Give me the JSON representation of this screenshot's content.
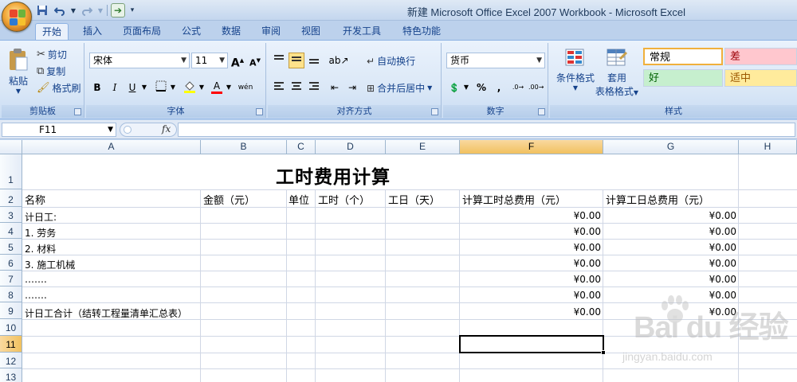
{
  "window": {
    "title": "新建 Microsoft Office Excel 2007 Workbook - Microsoft Excel"
  },
  "quick_access": {
    "save_icon": "save-icon",
    "undo_icon": "undo-icon",
    "redo_icon": "redo-icon",
    "run_icon": "arrow-right-icon"
  },
  "tabs": [
    {
      "label": "开始",
      "active": true
    },
    {
      "label": "插入"
    },
    {
      "label": "页面布局"
    },
    {
      "label": "公式"
    },
    {
      "label": "数据"
    },
    {
      "label": "审阅"
    },
    {
      "label": "视图"
    },
    {
      "label": "开发工具"
    },
    {
      "label": "特色功能"
    }
  ],
  "ribbon": {
    "clipboard": {
      "group_label": "剪贴板",
      "paste": "粘贴",
      "cut": "剪切",
      "copy": "复制",
      "format_painter": "格式刷"
    },
    "font": {
      "group_label": "字体",
      "font_name": "宋体",
      "font_size": "11",
      "grow": "A",
      "shrink": "A",
      "bold": "B",
      "italic": "I",
      "underline": "U",
      "font_color_letter": "A",
      "phonetic": "wén"
    },
    "alignment": {
      "group_label": "对齐方式",
      "wrap_text": "自动换行",
      "merge_center": "合并后居中"
    },
    "number": {
      "group_label": "数字",
      "format": "货币",
      "percent": "%",
      "comma": ","
    },
    "styles": {
      "group_label": "样式",
      "conditional_formatting": "条件格式",
      "format_as_table_1": "套用",
      "format_as_table_2": "表格格式",
      "normal": "常规",
      "bad": "差",
      "good": "好",
      "neutral": "适中",
      "colors": {
        "bad_bg": "#ffc7ce",
        "bad_fg": "#9c0006",
        "good_bg": "#c6efce",
        "good_fg": "#006100",
        "neutral_bg": "#ffeb9c",
        "neutral_fg": "#9c5700"
      }
    }
  },
  "formula_bar": {
    "name_box": "F11",
    "fx": "fx",
    "content": ""
  },
  "sheet": {
    "columns": [
      "A",
      "B",
      "C",
      "D",
      "E",
      "F",
      "G",
      "H"
    ],
    "selected_column": "F",
    "rows": [
      "1",
      "2",
      "3",
      "4",
      "5",
      "6",
      "7",
      "8",
      "9",
      "10",
      "11",
      "12",
      "13"
    ],
    "selected_row": "11",
    "title": "工时费用计算",
    "headers": {
      "A": "名称",
      "B": "金额（元）",
      "C": "单位",
      "D": "工时（个）",
      "E": "工日（天）",
      "F": "计算工时总费用（元）",
      "G": "计算工日总费用（元）"
    },
    "col_a": [
      "计日工:",
      "1. 劳务",
      "2. 材料",
      "3. 施工机械",
      "…….",
      "…….",
      "计日工合计（结转工程量清单汇总表）"
    ],
    "col_f": [
      "¥0.00",
      "¥0.00",
      "¥0.00",
      "¥0.00",
      "¥0.00",
      "¥0.00",
      "¥0.00"
    ],
    "col_g": [
      "¥0.00",
      "¥0.00",
      "¥0.00",
      "¥0.00",
      "¥0.00",
      "¥0.00",
      "¥0.00"
    ],
    "active_cell": "F11"
  },
  "watermark": {
    "brand": "Bai du 经验",
    "url": "jingyan.baidu.com"
  }
}
